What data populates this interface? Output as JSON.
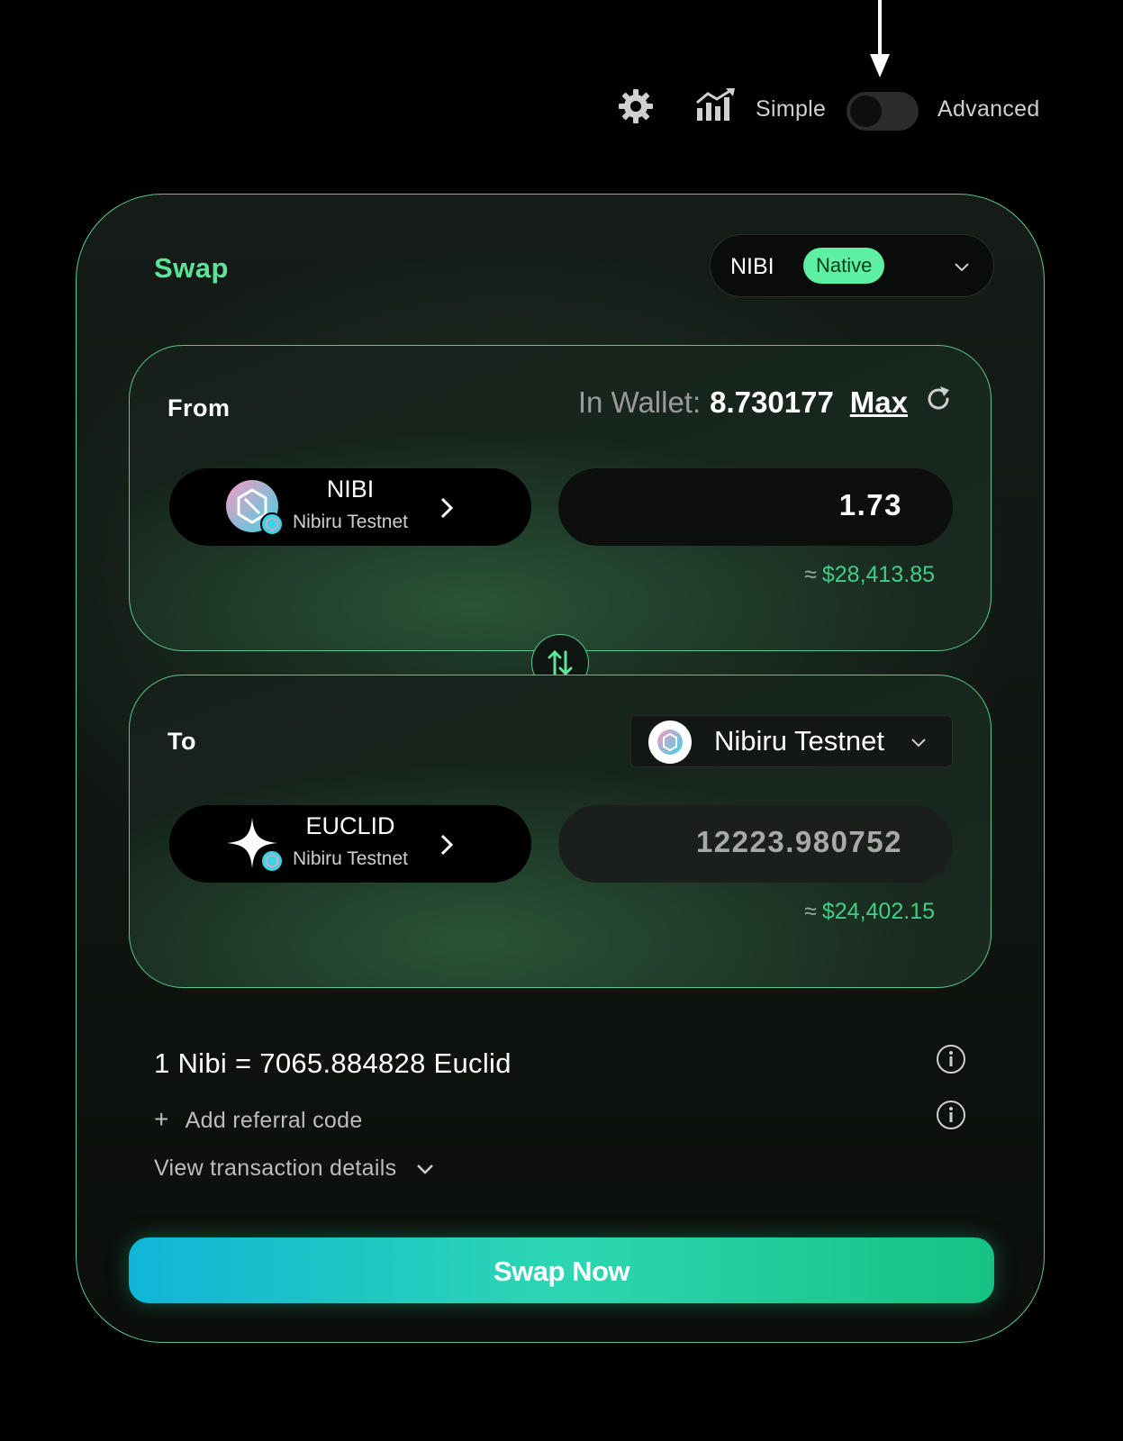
{
  "header": {
    "settings_icon": "gear-icon",
    "chart_icon": "bar-chart-trend-icon",
    "mode_simple": "Simple",
    "mode_advanced": "Advanced",
    "advanced_mode_on": false
  },
  "card": {
    "title": "Swap",
    "chain_selector": {
      "chain": "NIBI",
      "badge": "Native"
    }
  },
  "from": {
    "label": "From",
    "wallet_label": "In Wallet:",
    "wallet_balance": "8.730177",
    "max_label": "Max",
    "token": {
      "symbol": "NIBI",
      "chain": "Nibiru Testnet"
    },
    "amount": "1.73",
    "usd_approx": "≈",
    "usd_value": "$28,413.85"
  },
  "to": {
    "label": "To",
    "chain": "Nibiru Testnet",
    "token": {
      "symbol": "EUCLID",
      "chain": "Nibiru Testnet"
    },
    "amount": "12223.980752",
    "usd_approx": "≈",
    "usd_value": "$24,402.15"
  },
  "details": {
    "rate": "1 Nibi = 7065.884828 Euclid",
    "referral_plus": "+",
    "referral_label": "Add referral code",
    "tx_details_label": "View transaction details"
  },
  "swap_button": "Swap Now",
  "colors": {
    "accent": "#5ee39a",
    "border": "#59c98b",
    "usd": "#3fcf85",
    "button_start": "#0fb6d8",
    "button_end": "#16c283"
  }
}
